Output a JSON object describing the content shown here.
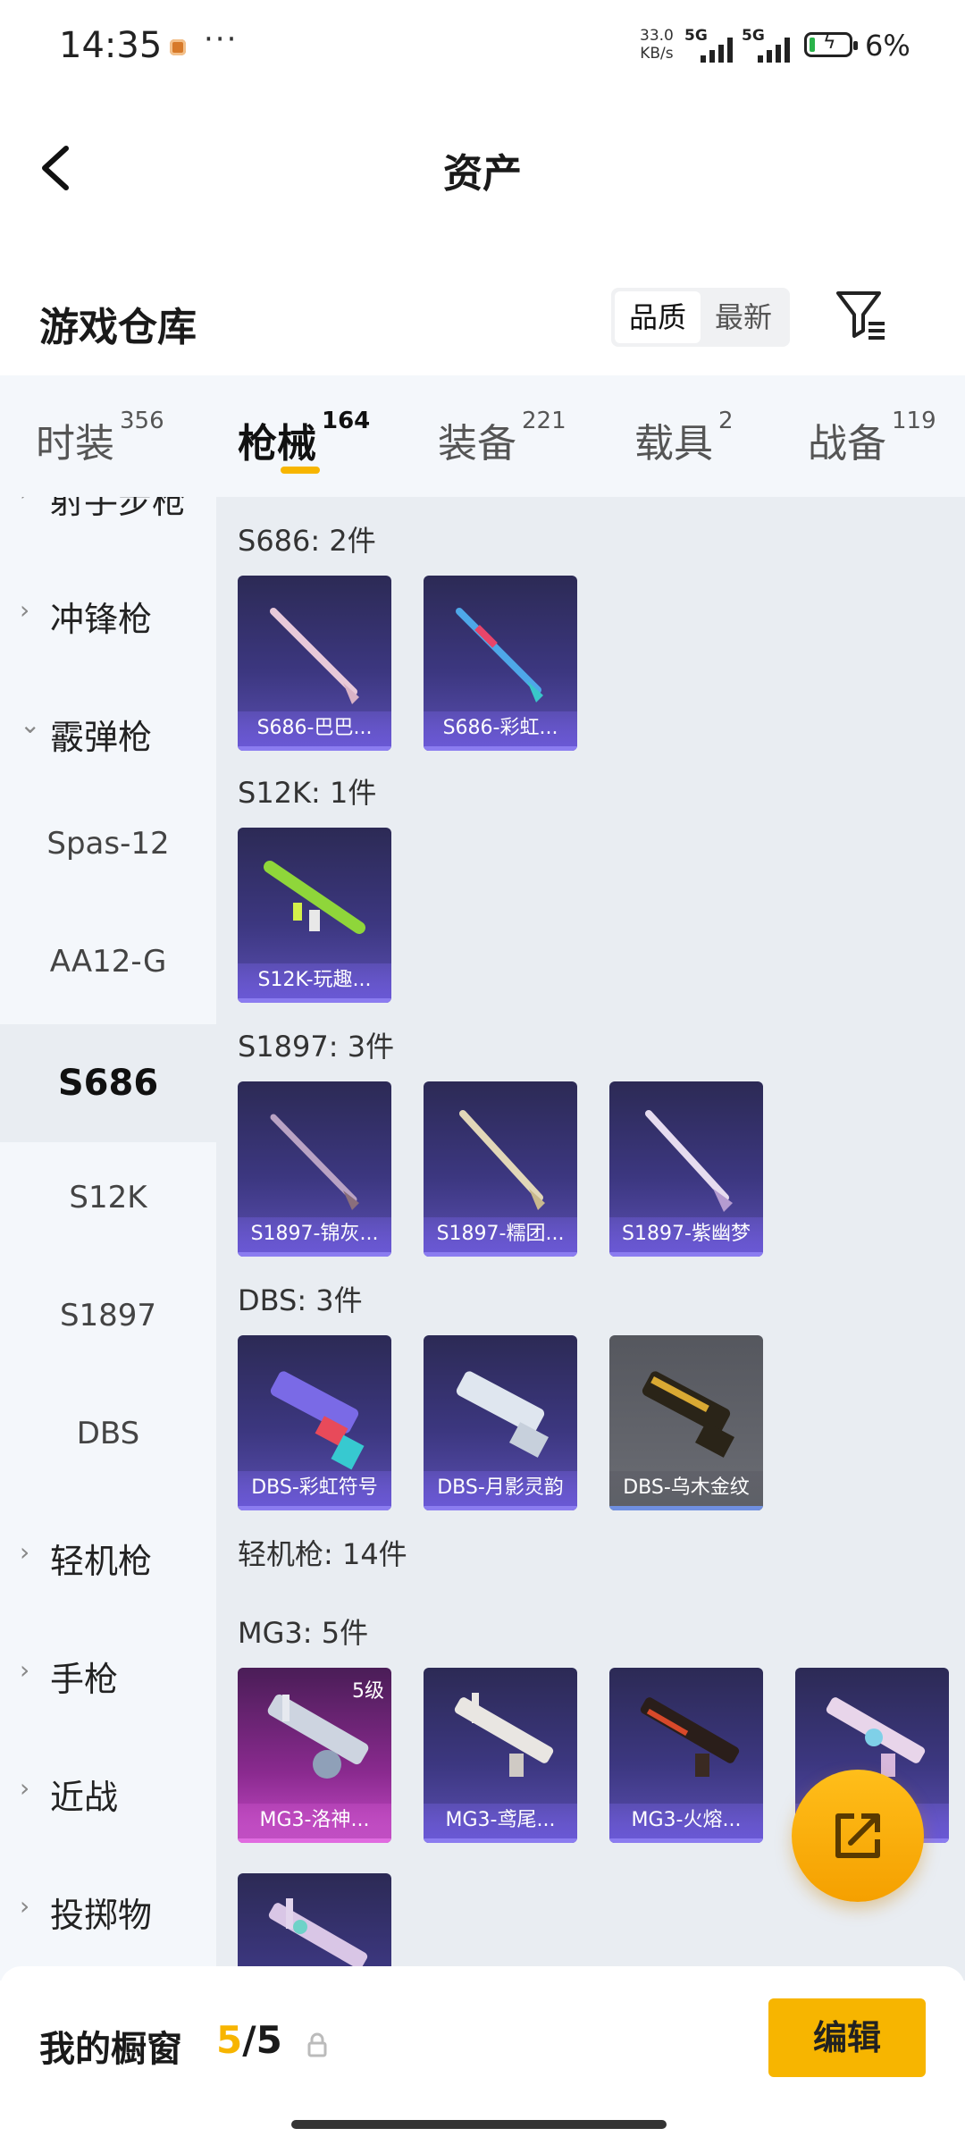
{
  "status_bar": {
    "time": "14:35",
    "net_speed_value": "33.0",
    "net_speed_unit": "KB/s",
    "sim1": "5G",
    "sim2": "5G",
    "battery": "6%"
  },
  "header": {
    "title": "资产"
  },
  "warehouse": {
    "title": "游戏仓库",
    "sort_options": [
      "品质",
      "最新"
    ],
    "active_sort": "品质"
  },
  "tabs": [
    {
      "label": "时装",
      "count": "356"
    },
    {
      "label": "枪械",
      "count": "164",
      "active": true
    },
    {
      "label": "装备",
      "count": "221"
    },
    {
      "label": "载具",
      "count": "2"
    },
    {
      "label": "战备",
      "count": "119"
    }
  ],
  "sidebar": {
    "partial_top": "射手步枪",
    "categories": [
      {
        "label": "冲锋枪",
        "expanded": false
      },
      {
        "label": "霰弹枪",
        "expanded": true
      },
      {
        "label": "轻机枪",
        "expanded": false
      },
      {
        "label": "手枪",
        "expanded": false
      },
      {
        "label": "近战",
        "expanded": false
      },
      {
        "label": "投掷物",
        "expanded": false
      }
    ],
    "subitems": [
      "Spas-12",
      "AA12-G",
      "S686",
      "S12K",
      "S1897",
      "DBS"
    ],
    "selected_subitem": "S686"
  },
  "groups": [
    {
      "title": "S686: 2件",
      "items": [
        "S686-巴巴...",
        "S686-彩虹..."
      ]
    },
    {
      "title": "S12K: 1件",
      "items": [
        "S12K-玩趣..."
      ]
    },
    {
      "title": "S1897: 3件",
      "items": [
        "S1897-锦灰...",
        "S1897-糯团...",
        "S1897-紫幽梦"
      ]
    },
    {
      "title": "DBS: 3件",
      "items": [
        "DBS-彩虹符号",
        "DBS-月影灵韵",
        "DBS-乌木金纹"
      ]
    },
    {
      "title": "轻机枪: 14件",
      "items": []
    },
    {
      "title": "MG3: 5件",
      "items": [
        "MG3-洛神...",
        "MG3-鸢尾...",
        "MG3-火熔...",
        ""
      ],
      "first_level": "5级"
    }
  ],
  "bottom_bar": {
    "label": "我的橱窗",
    "current": "5",
    "separator": "/",
    "total": "5",
    "edit_label": "编辑"
  },
  "colors": {
    "accent": "#f7b500",
    "card_purple": "#3c3780",
    "card_pink": "#8a2a8f"
  }
}
